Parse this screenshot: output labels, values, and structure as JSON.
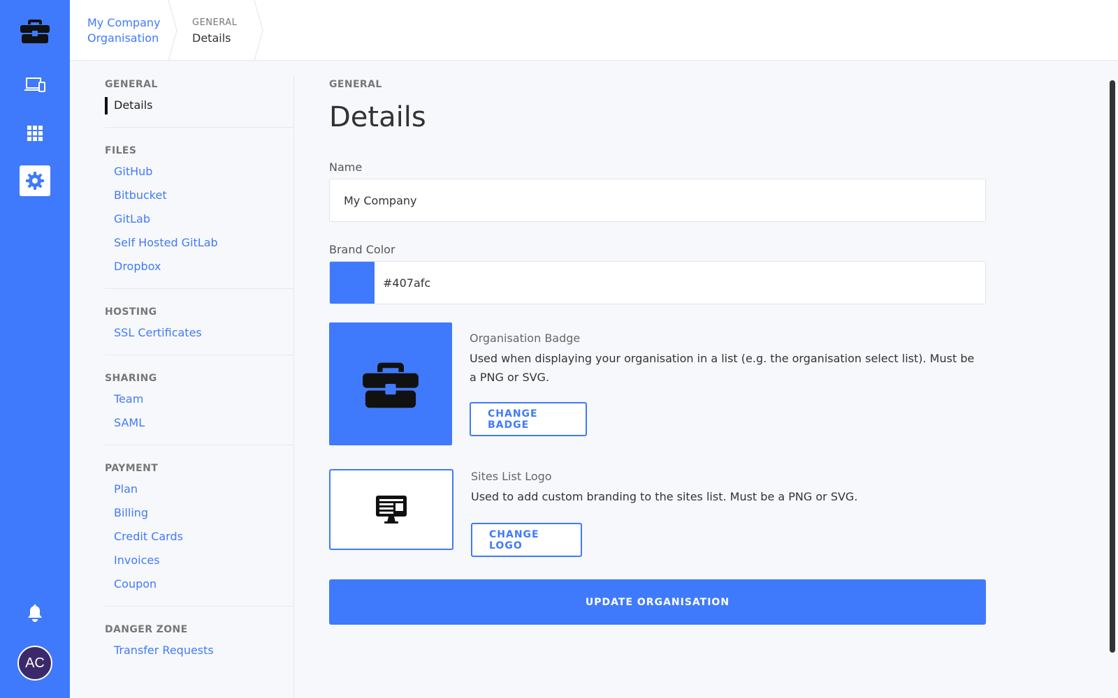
{
  "breadcrumb": {
    "org_line1": "My Company",
    "org_line2": "Organisation",
    "section_kicker": "GENERAL",
    "section_value": "Details"
  },
  "rail": {
    "avatar_initials": "AC",
    "icons": [
      "briefcase-icon",
      "devices-icon",
      "grid-icon",
      "gear-icon",
      "bell-icon"
    ]
  },
  "sidebar": {
    "groups": [
      {
        "title": "GENERAL",
        "items": [
          "Details"
        ]
      },
      {
        "title": "FILES",
        "items": [
          "GitHub",
          "Bitbucket",
          "GitLab",
          "Self Hosted GitLab",
          "Dropbox"
        ]
      },
      {
        "title": "HOSTING",
        "items": [
          "SSL Certificates"
        ]
      },
      {
        "title": "SHARING",
        "items": [
          "Team",
          "SAML"
        ]
      },
      {
        "title": "PAYMENT",
        "items": [
          "Plan",
          "Billing",
          "Credit Cards",
          "Invoices",
          "Coupon"
        ]
      },
      {
        "title": "DANGER ZONE",
        "items": [
          "Transfer Requests"
        ]
      }
    ],
    "active_item": "Details"
  },
  "main": {
    "kicker": "GENERAL",
    "title": "Details",
    "name_label": "Name",
    "name_value": "My Company",
    "brand_label": "Brand Color",
    "brand_value": "#407afc",
    "badge": {
      "title": "Organisation Badge",
      "description": "Used when displaying your organisation in a list (e.g. the organisation select list). Must be a PNG or SVG.",
      "button": "CHANGE BADGE"
    },
    "logo": {
      "title": "Sites List Logo",
      "description": "Used to add custom branding to the sites list. Must be a PNG or SVG.",
      "button": "CHANGE LOGO"
    },
    "submit": "UPDATE ORGANISATION"
  },
  "colors": {
    "accent": "#407afc",
    "background": "#f7f8fb",
    "avatar": "#3b2a6b"
  }
}
